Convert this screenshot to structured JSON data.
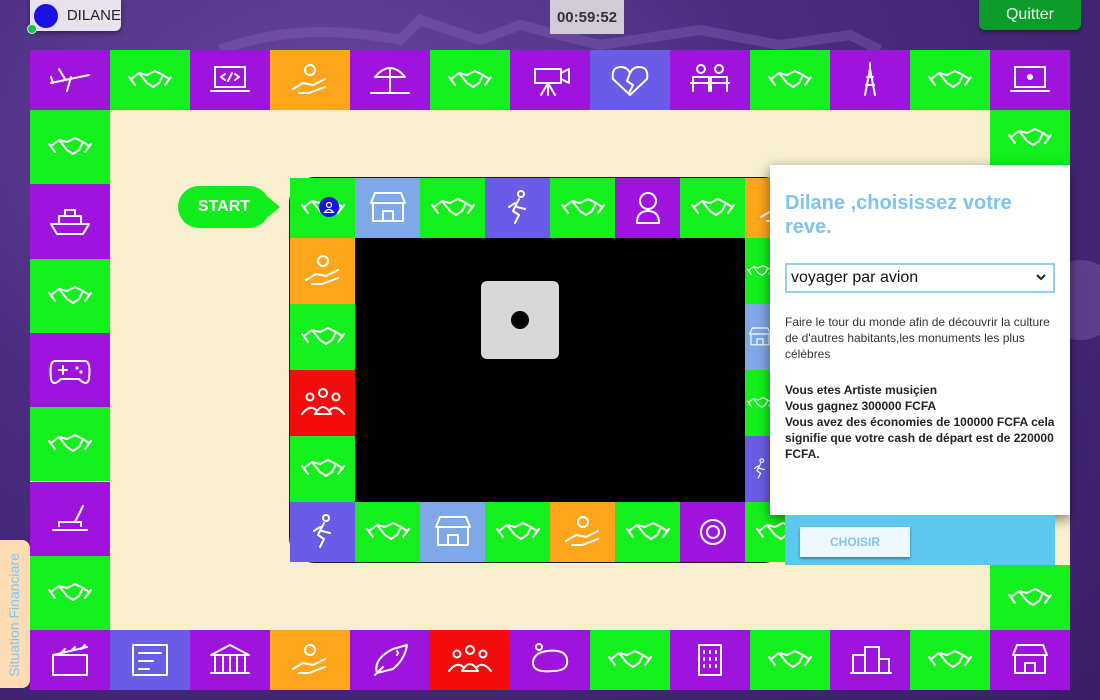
{
  "player": {
    "name": "DILANE",
    "color": "#1a12e0"
  },
  "timer": "00:59:52",
  "quit_label": "Quitter",
  "board": {
    "start_label": "START",
    "colors": {
      "green": "#14f01e",
      "purple": "#9e14dc",
      "orange": "#ffa51c",
      "blue": "#6a5ce6",
      "red": "#f50c0c",
      "light_blue": "#7ea8e8"
    },
    "outer_top": [
      "plane-icon",
      "handshake-icon",
      "code-laptop-icon",
      "deal-icon",
      "beach-icon",
      "handshake-icon",
      "camera-icon",
      "broken-heart-icon",
      "dinner-icon",
      "handshake-icon",
      "eiffel-tower-icon",
      "handshake-icon",
      "laptop-icon"
    ],
    "outer_top_colors": [
      "purple",
      "green",
      "purple",
      "orange",
      "purple",
      "green",
      "purple",
      "blue",
      "purple",
      "green",
      "purple",
      "green",
      "purple"
    ],
    "outer_left": [
      "handshake-icon",
      "ship-icon",
      "handshake-icon",
      "gamepad-icon",
      "handshake-icon",
      "paint-icon",
      "handshake-icon"
    ],
    "outer_left_colors": [
      "green",
      "purple",
      "green",
      "purple",
      "green",
      "purple",
      "green"
    ],
    "outer_bottom": [
      "clapperboard-icon",
      "tax-icon",
      "bank-icon",
      "deal-icon",
      "rocket-icon",
      "group-icon",
      "soap-icon",
      "handshake-icon",
      "building-icon",
      "handshake-icon",
      "city-icon",
      "handshake-icon",
      "shop-icon"
    ],
    "outer_bottom_colors": [
      "purple",
      "blue",
      "purple",
      "orange",
      "purple",
      "red",
      "purple",
      "green",
      "purple",
      "green",
      "purple",
      "green",
      "purple"
    ],
    "outer_right": [
      "handshake-icon",
      "handshake-icon"
    ],
    "inner_top": [
      "handshake-icon",
      "shop-icon",
      "handshake-icon",
      "runner-icon",
      "handshake-icon",
      "baby-icon",
      "handshake-icon",
      "deal-icon"
    ],
    "inner_top_colors": [
      "green",
      "light_blue",
      "green",
      "blue",
      "green",
      "purple",
      "green",
      "orange"
    ],
    "inner_left": [
      "deal-icon",
      "handshake-icon",
      "group-icon",
      "handshake-icon"
    ],
    "inner_left_colors": [
      "orange",
      "green",
      "red",
      "green"
    ],
    "inner_bottom": [
      "runner-icon",
      "handshake-icon",
      "shop-icon",
      "handshake-icon",
      "deal-icon",
      "handshake-icon",
      "virus-icon",
      "handshake-icon"
    ],
    "inner_bottom_colors": [
      "blue",
      "green",
      "light_blue",
      "green",
      "orange",
      "green",
      "purple",
      "green"
    ],
    "dice_value": 1
  },
  "modal": {
    "title": "Dilane ,choisissez votre reve.",
    "selected_dream": "voyager par avion",
    "description": "Faire le tour du monde afin de découvrir la culture de d'autres habitants,les monuments les plus célèbres",
    "info_line1": "Vous etes Artiste musiçien",
    "info_line2": "Vous gagnez 300000 FCFA",
    "info_line3": "Vous avez des économies de 100000 FCFA cela signifie que votre cash de départ est de 220000 FCFA.",
    "choose_label": "CHOISIR"
  },
  "side_tab_label": "Situation Financiare"
}
